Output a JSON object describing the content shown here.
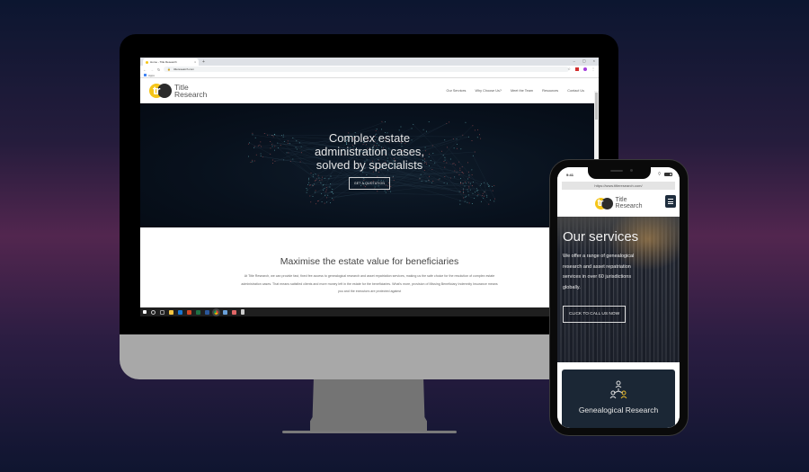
{
  "background": {
    "gradient_colors": [
      "#0c1630",
      "#52264f",
      "#0f1530"
    ]
  },
  "desktop": {
    "browser": {
      "tab_title": "Home - Title Research",
      "tab_close": "×",
      "new_tab": "+",
      "window_controls": [
        "–",
        "▢",
        "×"
      ],
      "url": "titleresearch.com",
      "bookmarks_label": "Apps"
    },
    "site": {
      "logo": {
        "glyph": "tr",
        "line1": "Title",
        "line2": "Research",
        "colors": {
          "yellow": "#f5c518",
          "dark": "#2b2b2b"
        }
      },
      "nav": [
        "Our Services",
        "Why Choose Us?",
        "Meet the Team",
        "Resources",
        "Contact Us"
      ],
      "hero": {
        "title_lines": [
          "Complex estate",
          "administration cases,",
          "solved by specialists"
        ],
        "button": "GET A QUOTATION"
      },
      "section": {
        "heading": "Maximise the estate value for beneficiaries",
        "body": "At Title Research, we can provide fast, fixed fee access to genealogical research and asset repatriation services, making us the safe choice for the resolution of complex estate administration cases. That means satisfied clients and more money left in the estate for the beneficiaries. What's more, provision of Missing Beneficiary Indemnity Insurance means you and the executors are protected against"
      }
    },
    "taskbar_icons": [
      "windows-start",
      "cortana",
      "task-view",
      "file-explorer",
      "outlook",
      "powerpoint",
      "excel",
      "word",
      "chrome",
      "paint",
      "snipping-tool",
      "calculator"
    ]
  },
  "mobile": {
    "status_time": "9:41",
    "url": "https://www.titleresearch.com/",
    "logo": {
      "glyph": "tr",
      "line1": "Title",
      "line2": "Research"
    },
    "hero": {
      "title": "Our services",
      "body": "We offer a range of genealogical research and asset repatriation services in over 60 jurisdictions globally.",
      "button": "CLICK TO CALL US NOW"
    },
    "card": {
      "title": "Genealogical Research",
      "accent": "#e2b52a"
    }
  }
}
